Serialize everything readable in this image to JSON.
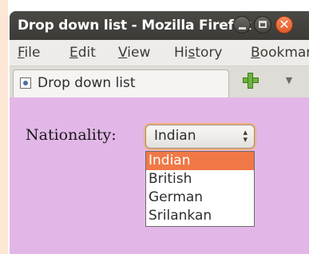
{
  "window": {
    "title": "Drop down list - Mozilla Firefox"
  },
  "menubar": {
    "items": [
      {
        "key": "F",
        "rest": "ile"
      },
      {
        "key": "E",
        "rest": "dit"
      },
      {
        "key": "V",
        "rest": "iew"
      },
      {
        "key": "s",
        "pre": "Hi",
        "rest": "tory"
      },
      {
        "key": "B",
        "rest": "ookmarks"
      }
    ]
  },
  "tab": {
    "label": "Drop down list"
  },
  "form": {
    "label": "Nationality:",
    "selected": "Indian",
    "options": [
      "Indian",
      "British",
      "German",
      "Srilankan"
    ]
  },
  "colors": {
    "accent": "#f07846",
    "page_background": "#e2b7e7",
    "titlebar": "#3c3b37"
  },
  "icons": [
    "page-icon",
    "new-tab-plus-icon",
    "tab-list-chevron-icon",
    "minimize-icon",
    "maximize-icon",
    "close-icon",
    "select-arrows-icon"
  ]
}
